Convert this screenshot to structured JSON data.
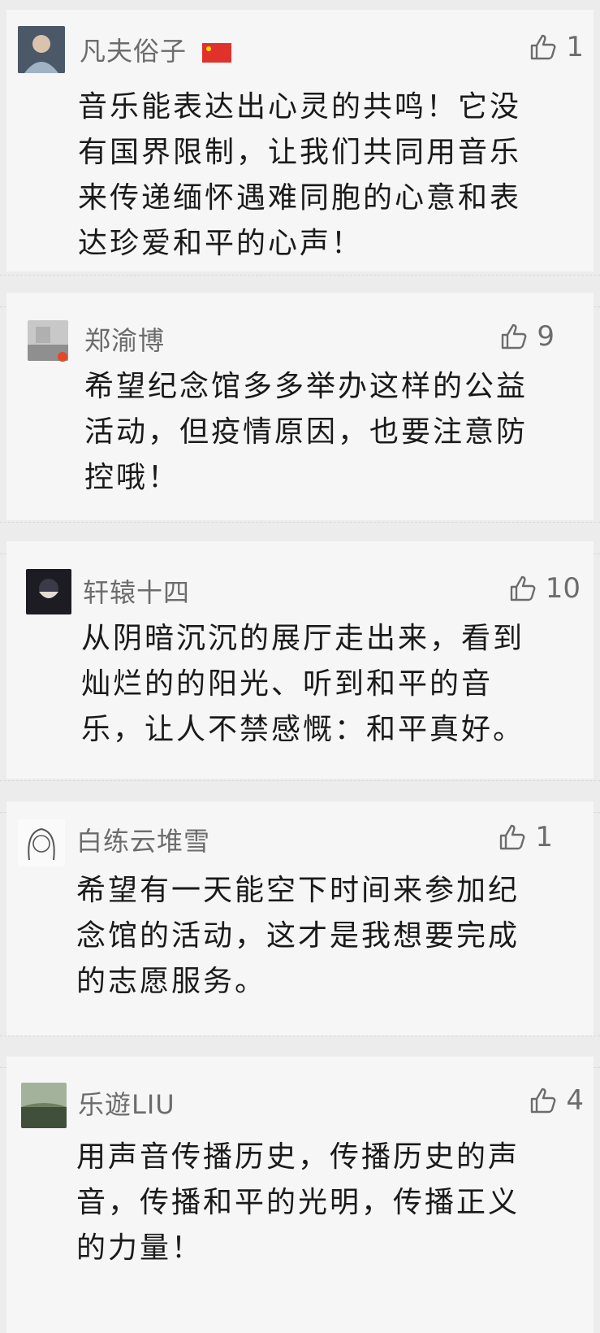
{
  "comments": [
    {
      "name": "凡夫俗子",
      "likes": "1",
      "text": "音乐能表达出心灵的共鸣！它没\n有国界限制，让我们共同用音乐\n来传递缅怀遇难同胞的心意和表\n达珍爱和平的心声！",
      "avatar_icon": "portrait-avatar-icon",
      "badge_icon": "china-flag-icon"
    },
    {
      "name": "郑渝博",
      "likes": "9",
      "text": "希望纪念馆多多举办这样的公益\n活动，但疫情原因，也要注意防\n控哦！",
      "avatar_icon": "photo-avatar-icon"
    },
    {
      "name": "轩辕十四",
      "likes": "10",
      "text": "从阴暗沉沉的展厅走出来，看到\n灿烂的的阳光、听到和平的音\n乐，让人不禁感慨：和平真好。",
      "avatar_icon": "dark-avatar-icon"
    },
    {
      "name": "白练云堆雪",
      "likes": "1",
      "text": "希望有一天能空下时间来参加纪\n念馆的活动，这才是我想要完成\n的志愿服务。",
      "avatar_icon": "sketch-avatar-icon"
    },
    {
      "name": "乐遊LIU",
      "likes": "4",
      "text": "用声音传播历史，传播历史的声\n音，传播和平的光明，传播正义\n的力量！",
      "avatar_icon": "landscape-avatar-icon"
    }
  ],
  "colors": {
    "card": "#f6f6f6",
    "background": "#ececec",
    "name": "#6c6c6c",
    "text": "#1a1a1a"
  }
}
